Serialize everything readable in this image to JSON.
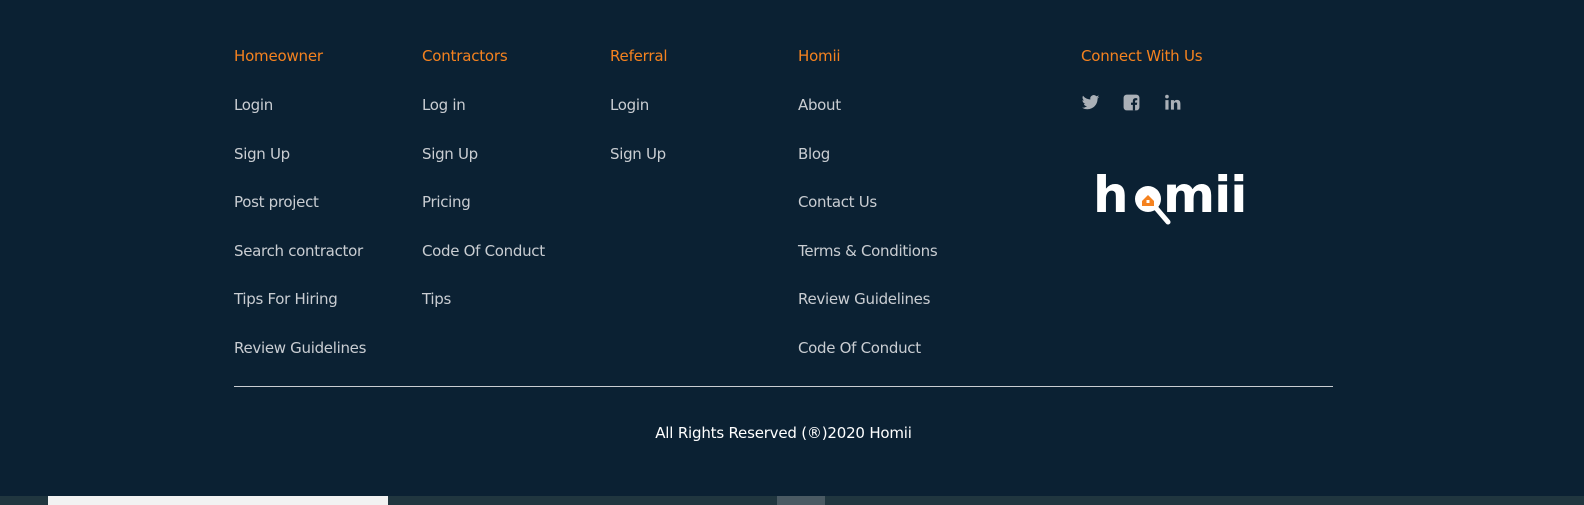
{
  "colors": {
    "background": "#0b2133",
    "accent": "#f5821f",
    "link": "#c9cdd2"
  },
  "columns": [
    {
      "heading": "Homeowner",
      "links": [
        "Login",
        "Sign Up",
        "Post project",
        "Search contractor",
        "Tips For Hiring",
        "Review Guidelines"
      ]
    },
    {
      "heading": "Contractors",
      "links": [
        "Log in",
        "Sign Up",
        "Pricing",
        "Code Of Conduct",
        "Tips"
      ]
    },
    {
      "heading": "Referral",
      "links": [
        "Login",
        "Sign Up"
      ]
    },
    {
      "heading": "Homii",
      "links": [
        "About",
        "Blog",
        "Contact Us",
        "Terms & Conditions",
        "Review Guidelines",
        "Code Of Conduct"
      ]
    }
  ],
  "connect": {
    "heading": "Connect With Us",
    "icons": [
      "twitter-icon",
      "facebook-icon",
      "linkedin-icon"
    ]
  },
  "logo": {
    "text": "homii"
  },
  "copyright": "All Rights Reserved (®)2020 Homii"
}
